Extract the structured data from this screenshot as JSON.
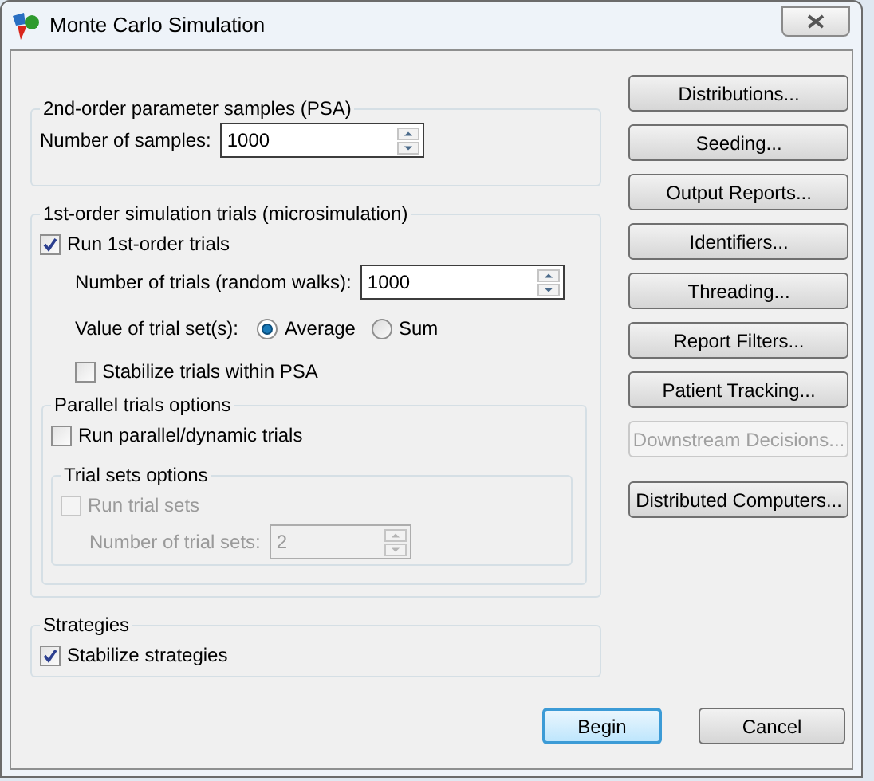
{
  "window": {
    "title": "Monte Carlo Simulation"
  },
  "psa_group": {
    "title": "2nd-order parameter samples (PSA)",
    "samples_label": "Number of samples:",
    "samples_value": "1000"
  },
  "microsimulation_group": {
    "title": "1st-order simulation trials (microsimulation)",
    "run_trials": {
      "label": "Run 1st-order trials",
      "checked": true
    },
    "trials_label": "Number of trials (random walks):",
    "trials_value": "1000",
    "trial_value_label": "Value of trial set(s):",
    "trial_value_options": [
      {
        "label": "Average",
        "selected": true
      },
      {
        "label": "Sum",
        "selected": false
      }
    ],
    "stabilize": {
      "label": "Stabilize trials within PSA",
      "checked": false
    },
    "parallel_group": {
      "title": "Parallel trials options",
      "run_parallel": {
        "label": "Run parallel/dynamic trials",
        "checked": false
      },
      "trial_sets_group": {
        "title": "Trial sets options",
        "run_trial_sets": {
          "label": "Run trial sets",
          "checked": false,
          "disabled": true
        },
        "count_label": "Number of trial sets:",
        "count_value": "2",
        "count_disabled": true
      }
    }
  },
  "strategies_group": {
    "title": "Strategies",
    "stabilize": {
      "label": "Stabilize strategies",
      "checked": true
    }
  },
  "tool_buttons": [
    {
      "label": "Distributions...",
      "disabled": false
    },
    {
      "label": "Seeding...",
      "disabled": false
    },
    {
      "label": "Output Reports...",
      "disabled": false
    },
    {
      "label": "Identifiers...",
      "disabled": false
    },
    {
      "label": "Threading...",
      "disabled": false
    },
    {
      "label": "Report Filters...",
      "disabled": false
    },
    {
      "label": "Patient Tracking...",
      "disabled": false
    },
    {
      "label": "Downstream Decisions...",
      "disabled": true
    }
  ],
  "extra_buttons": [
    {
      "label": "Distributed Computers...",
      "disabled": false
    }
  ],
  "buttons": [
    {
      "label": "Begin",
      "default": true
    },
    {
      "label": "Cancel",
      "default": false
    }
  ]
}
